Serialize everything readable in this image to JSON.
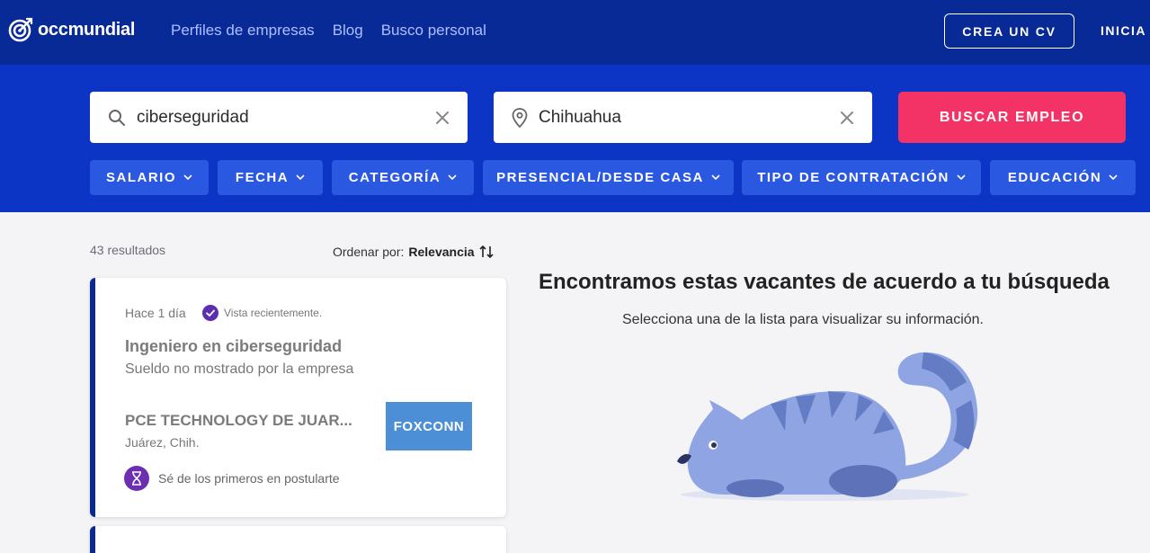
{
  "header": {
    "logo_text": "occmundial",
    "nav": [
      "Perfiles de empresas",
      "Blog",
      "Busco personal"
    ],
    "cv_button": "CREA UN CV",
    "login": "INICIA"
  },
  "search": {
    "keyword": "ciberseguridad",
    "location": "Chihuahua",
    "button": "BUSCAR EMPLEO",
    "filters": [
      "SALARIO",
      "FECHA",
      "CATEGORÍA",
      "PRESENCIAL/DESDE CASA",
      "TIPO DE CONTRATACIÓN",
      "EDUCACIÓN"
    ]
  },
  "results": {
    "count": "43 resultados",
    "sort_label": "Ordenar por:",
    "sort_value": "Relevancia"
  },
  "job_card": {
    "posted": "Hace 1 día",
    "viewed": "Vista recientemente.",
    "title": "Ingeniero en ciberseguridad",
    "salary": "Sueldo no mostrado por la empresa",
    "company": "PCE TECHNOLOGY DE JUAR...",
    "location": "Juárez, Chih.",
    "brand": "FOXCONN",
    "badge": "Sé de los primeros en postularte"
  },
  "empty_state": {
    "heading": "Encontramos estas vacantes de acuerdo a tu búsqueda",
    "subheading": "Selecciona una de la lista para visualizar su información."
  },
  "colors": {
    "topbar": "#082a97",
    "search_band": "#0d35c5",
    "filter": "#2a58e0",
    "cta": "#f33265",
    "card_accent": "#0a2a8f"
  },
  "icons": [
    "occ-logo-icon",
    "search-icon",
    "location-pin-icon",
    "close-icon",
    "chevron-down-icon",
    "sort-arrows-icon",
    "check-circle-icon",
    "hourglass-icon"
  ]
}
